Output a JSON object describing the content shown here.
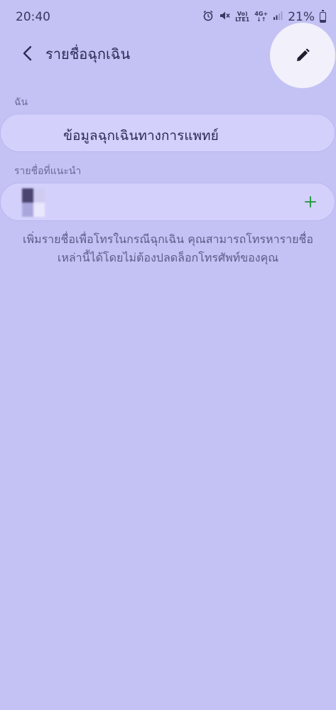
{
  "status_bar": {
    "time": "20:40",
    "volte_top": "Vo)",
    "volte_bottom": "LTE1",
    "network_top": "4G+",
    "network_bottom": "↓↑",
    "battery_percent": "21%",
    "battery_level": 0.21,
    "icons": [
      "alarm-icon",
      "mute-icon",
      "signal-icon",
      "battery-icon"
    ]
  },
  "app_bar": {
    "title": "รายชื่อฉุกเฉิน",
    "back_icon": "chevron-left-icon",
    "edit_icon": "pencil-icon"
  },
  "me_section": {
    "label": "ฉัน",
    "medical_info_label": "ข้อมูลฉุกเฉินทางการแพทย์"
  },
  "suggested_section": {
    "label": "รายชื่อที่แนะนำ",
    "add_icon": "plus-icon",
    "add_color": "#2e9a4a"
  },
  "hint": {
    "line1": "เพิ่มรายชื่อเพื่อโทรในกรณีฉุกเฉิน คุณสามารถโทรหารายชื่อ",
    "line2": "เหล่านี้ได้โดยไม่ต้องปลดล็อกโทรศัพท์ของคุณ"
  },
  "colors": {
    "background": "#c4c2f4",
    "card": "#d3d1fc",
    "edit_highlight": "#f2f0fa"
  }
}
